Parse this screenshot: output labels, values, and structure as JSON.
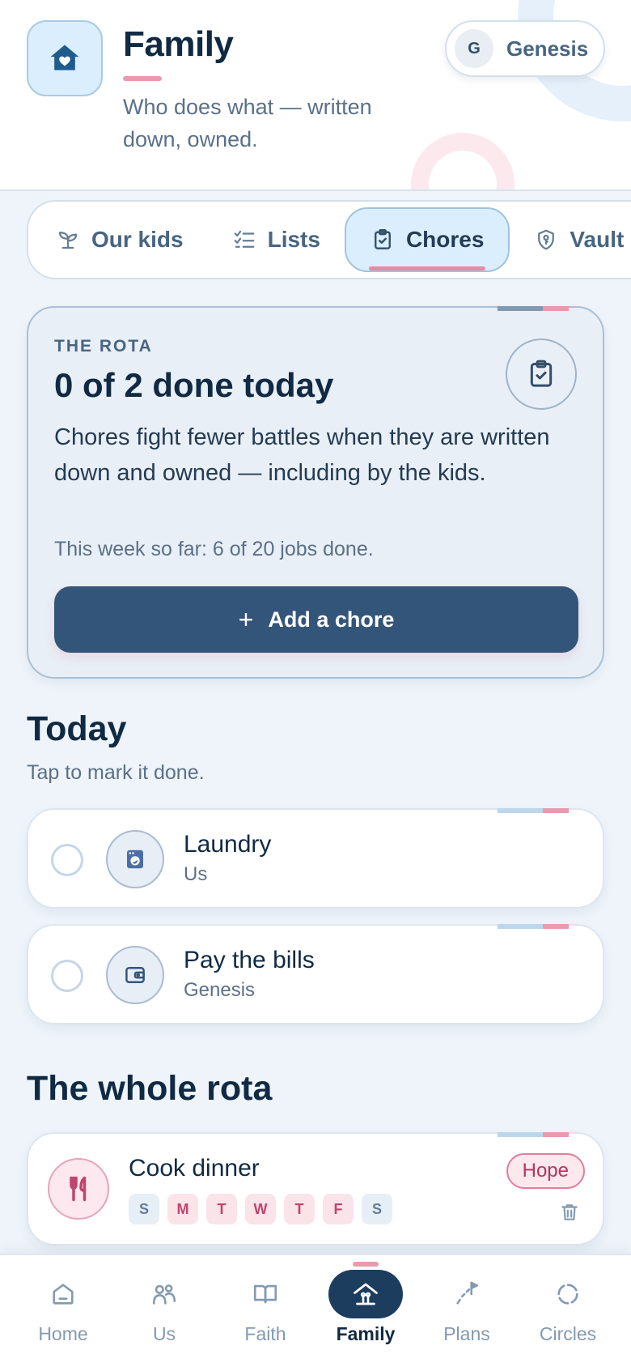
{
  "header": {
    "title": "Family",
    "subtitle": "Who does what — written down, owned.",
    "user": {
      "initial": "G",
      "name": "Genesis"
    }
  },
  "tabs": [
    {
      "label": "Our kids",
      "icon": "sprout-icon",
      "active": false
    },
    {
      "label": "Lists",
      "icon": "checklist-icon",
      "active": false
    },
    {
      "label": "Chores",
      "icon": "clipboard-check-icon",
      "active": true
    },
    {
      "label": "Vault",
      "icon": "shield-key-icon",
      "active": false
    }
  ],
  "rota_card": {
    "eyebrow": "THE ROTA",
    "heading": "0 of 2 done today",
    "description": "Chores fight fewer battles when they are written down and owned — including by the kids.",
    "week_summary": "This week so far: 6 of 20 jobs done.",
    "add_button": "Add a chore"
  },
  "today": {
    "title": "Today",
    "subtitle": "Tap to mark it done.",
    "chores": [
      {
        "name": "Laundry",
        "owner": "Us",
        "icon": "washing-machine-icon",
        "done": false
      },
      {
        "name": "Pay the bills",
        "owner": "Genesis",
        "icon": "wallet-icon",
        "done": false
      }
    ]
  },
  "whole_rota": {
    "title": "The whole rota",
    "items": [
      {
        "name": "Cook dinner",
        "owner": "Hope",
        "icon": "fork-knife-icon",
        "days": [
          {
            "label": "S",
            "active": false
          },
          {
            "label": "M",
            "active": true
          },
          {
            "label": "T",
            "active": true
          },
          {
            "label": "W",
            "active": true
          },
          {
            "label": "T",
            "active": true
          },
          {
            "label": "F",
            "active": true
          },
          {
            "label": "S",
            "active": false
          }
        ]
      }
    ]
  },
  "bottom_nav": [
    {
      "label": "Home",
      "icon": "home-icon",
      "active": false
    },
    {
      "label": "Us",
      "icon": "people-icon",
      "active": false
    },
    {
      "label": "Faith",
      "icon": "open-book-icon",
      "active": false
    },
    {
      "label": "Family",
      "icon": "family-home-icon",
      "active": true
    },
    {
      "label": "Plans",
      "icon": "flag-path-icon",
      "active": false
    },
    {
      "label": "Circles",
      "icon": "circle-dots-icon",
      "active": false
    }
  ],
  "colors": {
    "navy": "#102a43",
    "primary_button": "#34557a",
    "accent_pink": "#e89aae",
    "accent_blue": "#dbeefd"
  }
}
